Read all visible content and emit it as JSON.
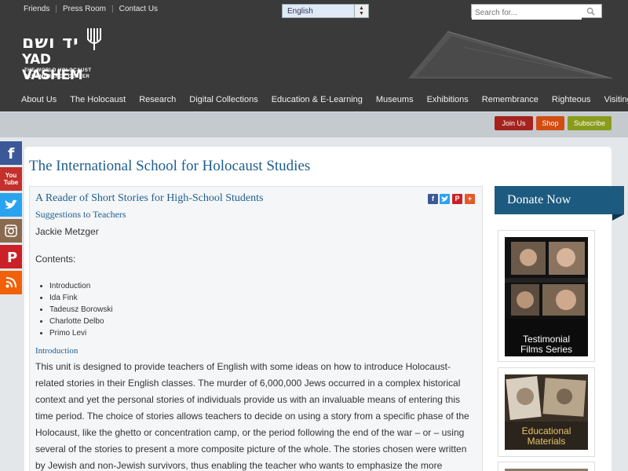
{
  "header": {
    "top_links": [
      "Friends",
      "Press Room",
      "Contact Us"
    ],
    "language_selected": "English",
    "search_placeholder": "Search for...",
    "logo": {
      "hebrew": "יד ושם",
      "name": "YAD VASHEM",
      "tagline_1": "THE WORLD HOLOCAUST",
      "tagline_2": "REMEMBRANCE CENTER"
    }
  },
  "nav": [
    "About Us",
    "The Holocaust",
    "Research",
    "Digital Collections",
    "Education & E-Learning",
    "Museums",
    "Exhibitions",
    "Remembrance",
    "Righteous",
    "Visiting"
  ],
  "actions": {
    "join": "Join Us",
    "shop": "Shop",
    "subscribe": "Subscribe"
  },
  "social_icons": [
    "facebook-icon",
    "youtube-icon",
    "twitter-icon",
    "instagram-icon",
    "pinterest-icon",
    "rss-icon"
  ],
  "social_labels": {
    "youtube_1": "You",
    "youtube_2": "Tube"
  },
  "page_title": "The International School for Holocaust Studies",
  "article": {
    "title": "A Reader of Short Stories for High-School Students",
    "subtitle": "Suggestions to Teachers",
    "author": "Jackie Metzger",
    "contents_label": "Contents:",
    "contents": [
      "Introduction",
      "Ida Fink",
      "Tadeusz Borowski",
      "Charlotte Delbo",
      "Primo Levi"
    ],
    "intro_heading": "Introduction",
    "intro_text": "This unit is designed to provide teachers of English with some ideas on how to introduce Holocaust-related stories in their English classes. The murder of 6,000,000 Jews occurred in a complex historical context and yet the personal stories of individuals provide us with an invaluable means of entering this time period. The choice of stories allows teachers to decide on using a story from a specific phase of the Holocaust, like the ghetto or concentration camp, or the period following the end of the war – or – using several of the stories to present a more composite picture of the whole. The stories chosen were written by Jewish and non-Jewish survivors, thus enabling the teacher who wants to emphasize the more universal character of the suffering"
  },
  "share_icons": [
    "facebook-share-icon",
    "twitter-share-icon",
    "pinterest-share-icon",
    "plus-share-icon"
  ],
  "sidebar": {
    "donate": "Donate Now",
    "promo_films_1": "Testimonial",
    "promo_films_2": "Films Series",
    "promo_edu_1": "Educational",
    "promo_edu_2": "Materials"
  },
  "colors": {
    "header_bg": "#3a3a3a",
    "title_blue": "#1e5e8e",
    "donate_bg": "#1c5a7f",
    "join_red": "#a4231d",
    "shop_orange": "#d24d12",
    "subscribe_olive": "#8a9c1c",
    "caption_gold": "#e8c36a"
  }
}
